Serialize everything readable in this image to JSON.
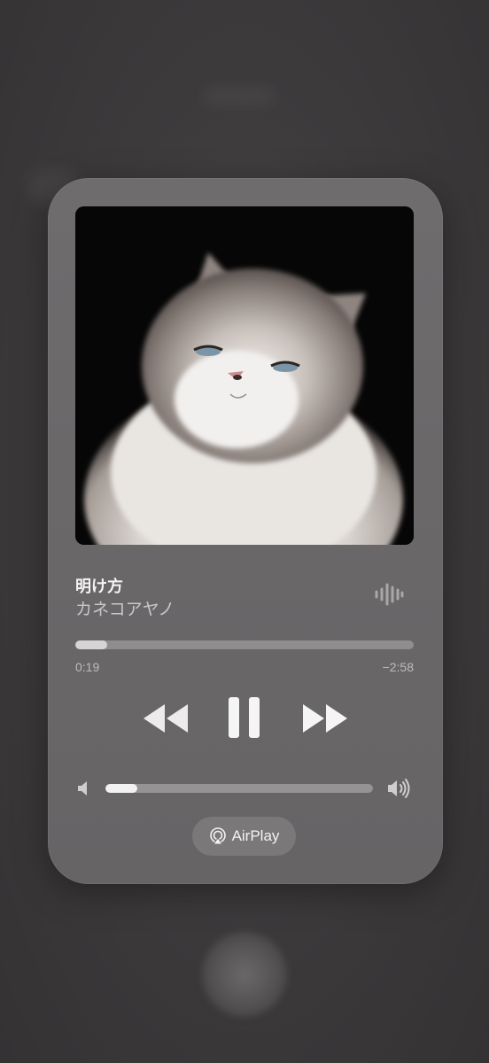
{
  "now_playing": {
    "title": "明け方",
    "artist": "カネコアヤノ",
    "progress_fraction": 0.095,
    "elapsed": "0:19",
    "remaining": "−2:58"
  },
  "controls": {
    "rewind_icon": "rewind-icon",
    "pause_icon": "pause-icon",
    "forward_icon": "fast-forward-icon"
  },
  "volume": {
    "level_fraction": 0.12,
    "low_icon": "speaker-low-icon",
    "high_icon": "speaker-high-icon"
  },
  "airplay": {
    "label": "AirPlay",
    "icon": "airplay-icon"
  },
  "colors": {
    "card": "#6a6869",
    "background": "#3a3839",
    "track": "#8f8d8e",
    "fill": "#d6d4d5",
    "icon": "#f5f5f5"
  }
}
